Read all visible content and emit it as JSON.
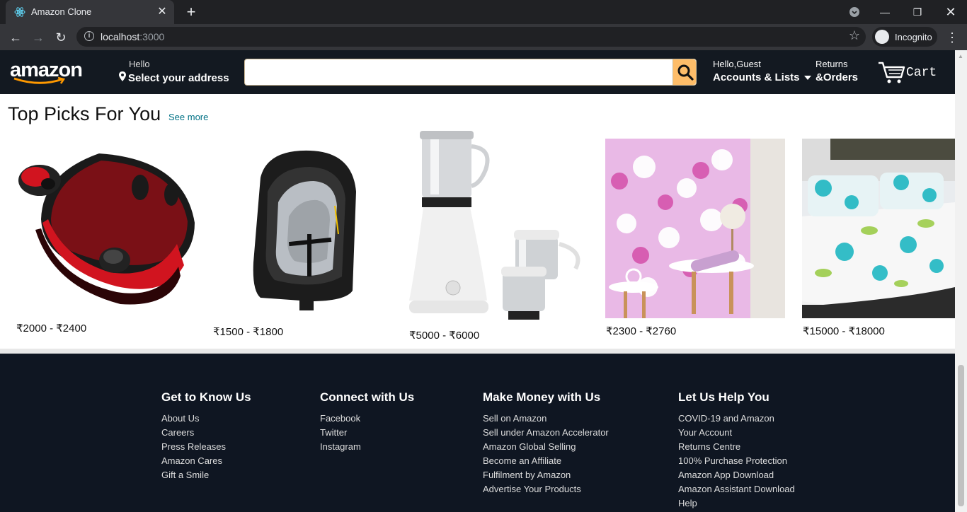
{
  "browser": {
    "tab_title": "Amazon Clone",
    "url_host": "localhost",
    "url_port": ":3000",
    "profile_label": "Incognito"
  },
  "header": {
    "logo": "amazon",
    "address_hello": "Hello",
    "address_label": "Select your address",
    "search_placeholder": "",
    "account_hello": "Hello,Guest",
    "account_label": "Accounts & Lists",
    "returns_top": "Returns",
    "returns_label": "&Orders",
    "cart_label": "Cart"
  },
  "picks": {
    "title": "Top Picks For You",
    "see_more": "See more",
    "products": [
      {
        "price": "₹2000 - ₹2400",
        "image": "red wireless earbuds in charging case"
      },
      {
        "price": "₹1500 - ₹1800",
        "image": "infant car seat carrier"
      },
      {
        "price": "₹5000 - ₹6000",
        "image": "mixer grinder with jars"
      },
      {
        "price": "₹2300 - ₹2760",
        "image": "floral wallpaper roll"
      },
      {
        "price": "₹15000 - ₹18000",
        "image": "bed with floral bedsheet"
      }
    ]
  },
  "footer": {
    "columns": [
      {
        "heading": "Get to Know Us",
        "links": [
          "About Us",
          "Careers",
          "Press Releases",
          "Amazon Cares",
          "Gift a Smile"
        ]
      },
      {
        "heading": "Connect with Us",
        "links": [
          "Facebook",
          "Twitter",
          "Instagram"
        ]
      },
      {
        "heading": "Make Money with Us",
        "links": [
          "Sell on Amazon",
          "Sell under Amazon Accelerator",
          "Amazon Global Selling",
          "Become an Affiliate",
          "Fulfilment by Amazon",
          "Advertise Your Products"
        ]
      },
      {
        "heading": "Let Us Help You",
        "links": [
          "COVID-19 and Amazon",
          "Your Account",
          "Returns Centre",
          "100% Purchase Protection",
          "Amazon App Download",
          "Amazon Assistant Download",
          "Help"
        ]
      }
    ]
  },
  "colors": {
    "header_bg": "#131921",
    "search_button": "#febd69",
    "footer_bg": "#0f1622",
    "link_teal": "#007185"
  }
}
